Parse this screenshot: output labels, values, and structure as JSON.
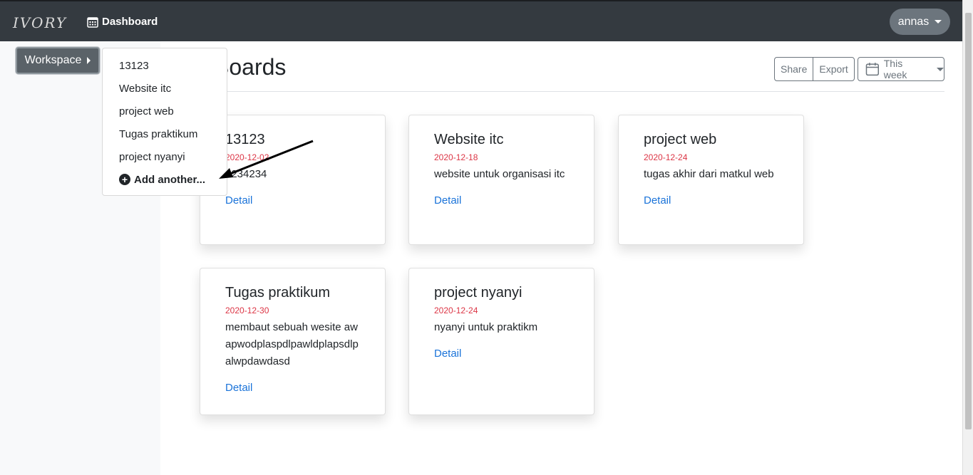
{
  "topbar": {
    "brand": "IVORY",
    "nav_label": "Dashboard",
    "nav_icon": "calendar-grid-icon",
    "user": "annas"
  },
  "workspace": {
    "button_label": "Workspace",
    "menu_items": [
      "13123",
      "Website itc",
      "project web",
      "Tugas praktikum",
      "project nyanyi"
    ],
    "add_label": "Add another..."
  },
  "main": {
    "title": "Boards",
    "share_label": "Share",
    "export_label": "Export",
    "period_label": "This week"
  },
  "boards": [
    {
      "title": "13123",
      "date": "2020-12-02",
      "description": "1234234",
      "link": "Detail"
    },
    {
      "title": "Website itc",
      "date": "2020-12-18",
      "description": "website untuk organisasi itc",
      "link": "Detail"
    },
    {
      "title": "project web",
      "date": "2020-12-24",
      "description": "tugas akhir dari matkul web",
      "link": "Detail"
    },
    {
      "title": "Tugas praktikum",
      "date": "2020-12-30",
      "description": "membaut sebuah wesite awapwodplaspdlpawldplapsdlpalwpdawdasd",
      "link": "Detail"
    },
    {
      "title": "project nyanyi",
      "date": "2020-12-24",
      "description": "nyanyi untuk praktikm",
      "link": "Detail"
    }
  ],
  "colors": {
    "topbar": "#343a40",
    "date": "#dc3545",
    "link": "#1a73d9"
  }
}
